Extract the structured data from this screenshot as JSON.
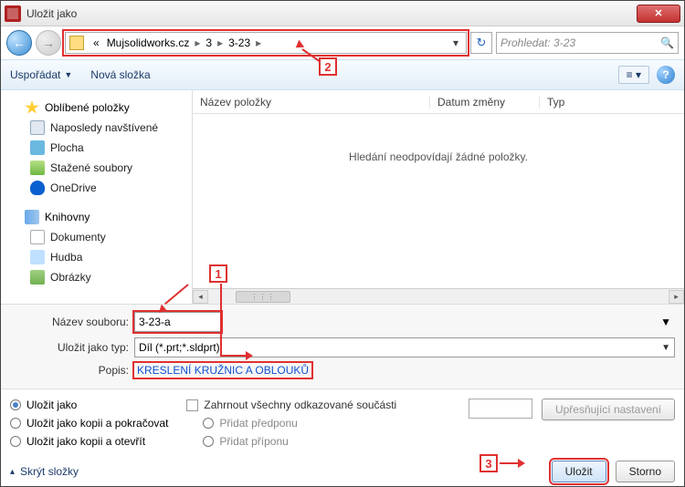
{
  "window": {
    "title": "Uložit jako"
  },
  "breadcrumb": {
    "prefix": "«",
    "items": [
      "Mujsolidworks.cz",
      "3",
      "3-23"
    ]
  },
  "search": {
    "placeholder": "Prohledat: 3-23"
  },
  "toolbar": {
    "organize": "Uspořádat",
    "newfolder": "Nová složka"
  },
  "tree": {
    "favorites": {
      "label": "Oblíbené položky",
      "items": [
        "Naposledy navštívené",
        "Plocha",
        "Stažené soubory",
        "OneDrive"
      ]
    },
    "libraries": {
      "label": "Knihovny",
      "items": [
        "Dokumenty",
        "Hudba",
        "Obrázky"
      ]
    }
  },
  "columns": {
    "name": "Název položky",
    "date": "Datum změny",
    "type": "Typ"
  },
  "empty_msg": "Hledání neodpovídají žádné položky.",
  "form": {
    "filename_label": "Název souboru:",
    "filename_value": "3-23-a",
    "filetype_label": "Uložit jako typ:",
    "filetype_value": "Díl (*.prt;*.sldprt)",
    "desc_label": "Popis:",
    "desc_value": "KRESLENÍ KRUŽNIC A OBLOUKŮ"
  },
  "options": {
    "save_as": "Uložit jako",
    "save_copy_continue": "Uložit jako kopii a pokračovat",
    "save_copy_open": "Uložit jako kopii a otevřít",
    "include_refs": "Zahrnout všechny odkazované součásti",
    "add_prefix": "Přidat předponu",
    "add_suffix": "Přidat příponu",
    "advanced": "Upřesňující nastavení"
  },
  "buttons": {
    "save": "Uložit",
    "cancel": "Storno",
    "hide_folders": "Skrýt složky"
  },
  "annotations": {
    "a1": "1",
    "a2": "2",
    "a3": "3"
  }
}
